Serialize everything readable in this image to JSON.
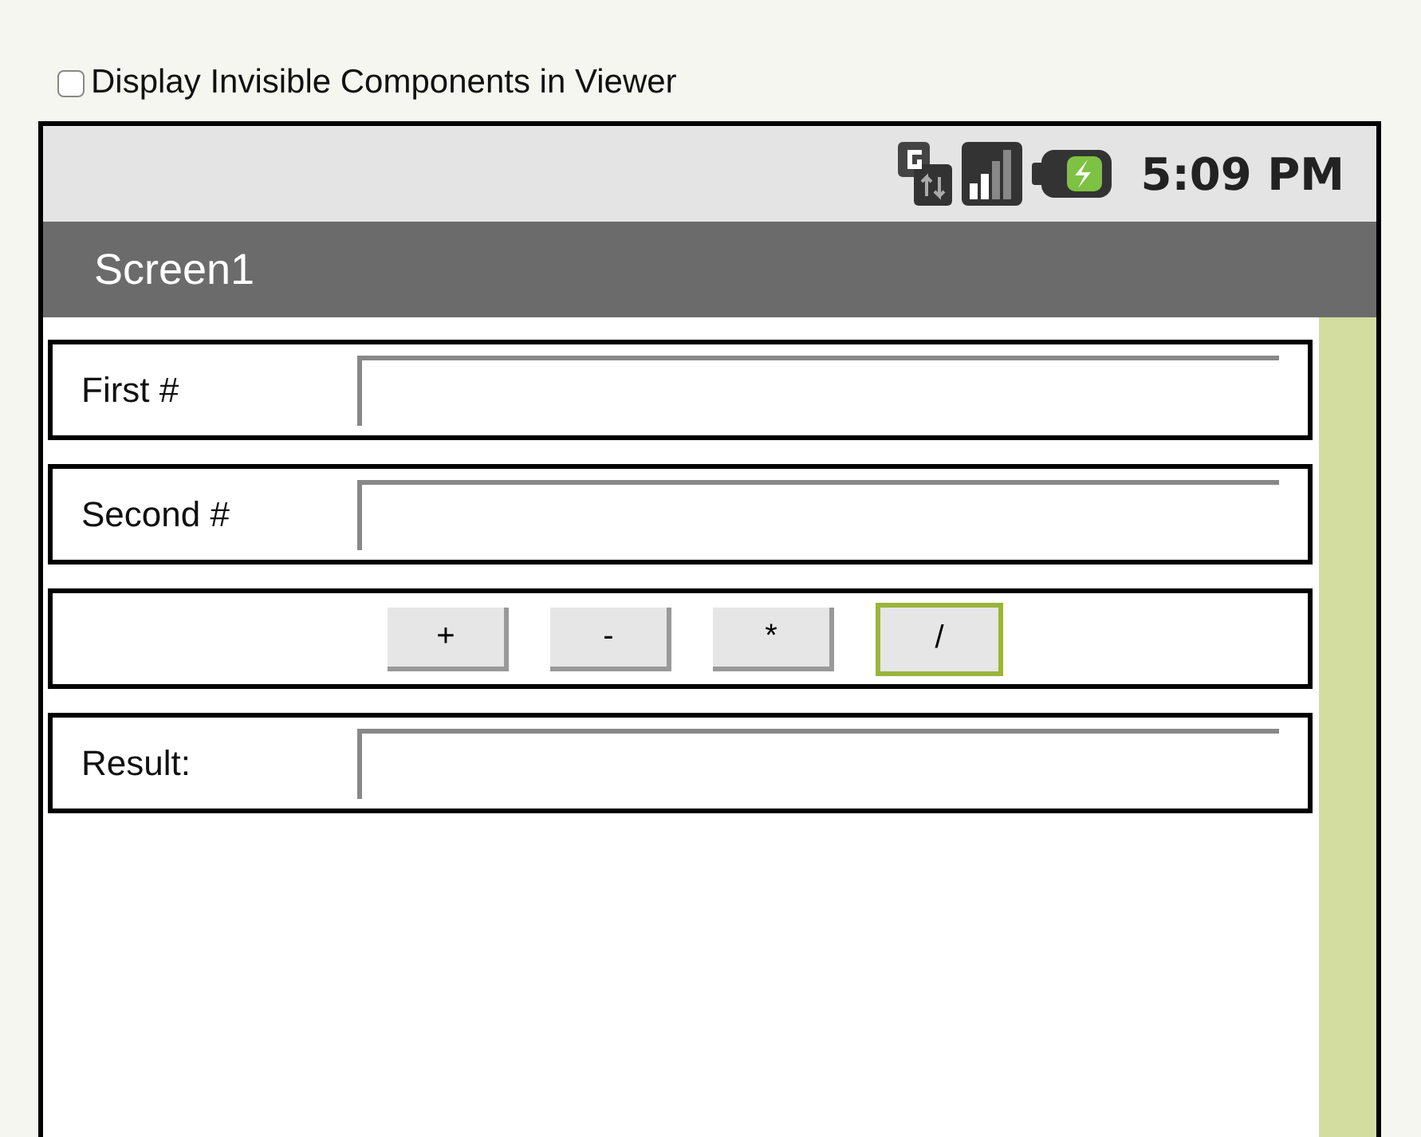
{
  "checkbox": {
    "label": "Display Invisible Components in Viewer",
    "checked": false
  },
  "status_bar": {
    "time": "5:09 PM"
  },
  "screen": {
    "title": "Screen1",
    "rows": [
      {
        "kind": "field",
        "label": "First #"
      },
      {
        "kind": "field",
        "label": "Second #"
      },
      {
        "kind": "buttons",
        "buttons": [
          {
            "label": "+",
            "selected": false
          },
          {
            "label": "-",
            "selected": false
          },
          {
            "label": "*",
            "selected": false
          },
          {
            "label": "/",
            "selected": true
          }
        ]
      },
      {
        "kind": "field",
        "label": "Result:"
      }
    ]
  }
}
